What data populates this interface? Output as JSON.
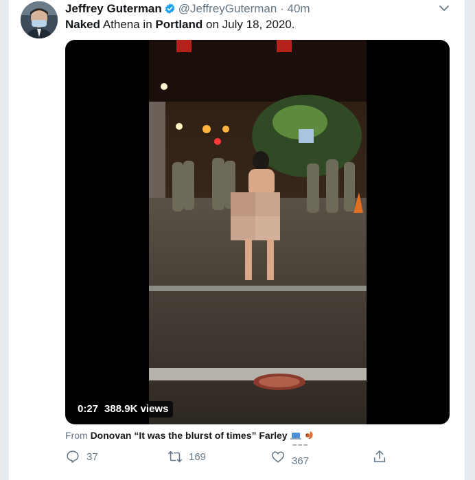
{
  "tweet": {
    "author_name": "Jeffrey Guterman",
    "author_handle": "@JeffreyGuterman",
    "separator": "·",
    "time": "40m",
    "text_parts": [
      "Naked",
      " Athena in ",
      "Portland",
      " on July 18, 2020."
    ]
  },
  "video": {
    "duration": "0:27",
    "views": "388.9K views"
  },
  "source": {
    "prefix": "From ",
    "name": "Donovan “It was the blurst of times” Farley"
  },
  "actions": {
    "reply_count": "37",
    "retweet_count": "169",
    "like_count": "367"
  },
  "icons": {
    "verified": "verified-badge-icon",
    "chevron": "chevron-down-icon",
    "reply": "reply-icon",
    "retweet": "retweet-icon",
    "like": "heart-icon",
    "share": "share-icon"
  },
  "colors": {
    "verified_blue": "#1da1f2",
    "muted_text": "#657786",
    "name_text": "#14171a"
  }
}
